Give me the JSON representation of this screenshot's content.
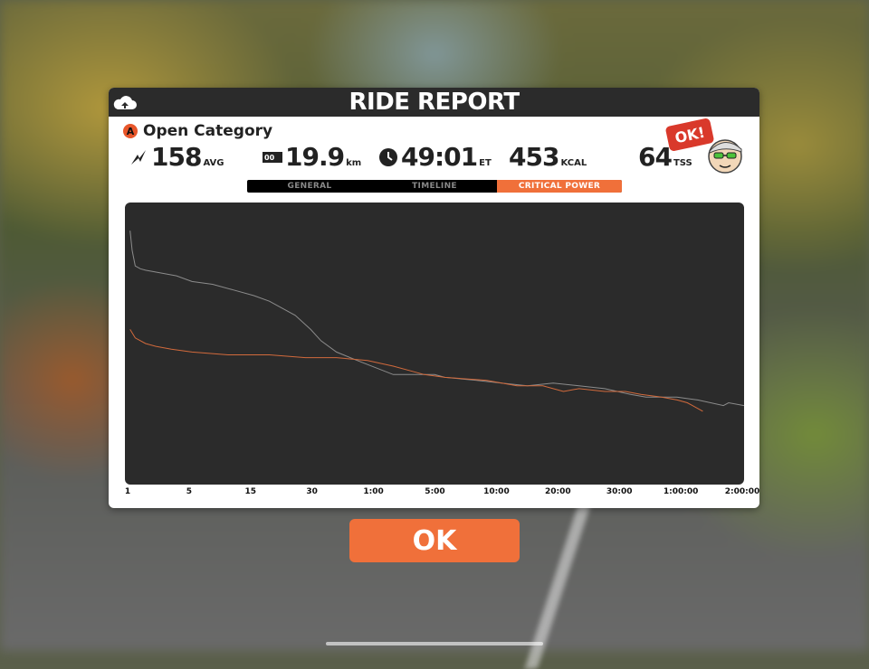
{
  "header": {
    "title": "RIDE REPORT"
  },
  "category": {
    "badge": "A",
    "name": "Open Category"
  },
  "stats": {
    "power": {
      "value": "158",
      "unit": "AVG"
    },
    "distance": {
      "value": "19.9",
      "unit": "km"
    },
    "time": {
      "value": "49:01",
      "unit": "ET"
    },
    "calories": {
      "value": "453",
      "unit": "KCAL"
    },
    "tss": {
      "value": "64",
      "unit": "TSS"
    }
  },
  "ok_bubble": "OK!",
  "tabs": [
    {
      "label": "GENERAL",
      "active": false
    },
    {
      "label": "TIMELINE",
      "active": false
    },
    {
      "label": "CRITICAL POWER",
      "active": true
    }
  ],
  "chart_data": {
    "type": "line",
    "x_ticks": [
      "1",
      "5",
      "15",
      "30",
      "1:00",
      "5:00",
      "10:00",
      "20:00",
      "30:00",
      "1:00:00",
      "2:00:00"
    ],
    "series": [
      {
        "color": "#8c8c8c",
        "values": [
          [
            1,
            0.1
          ],
          [
            1.4,
            0.17
          ],
          [
            2,
            0.225
          ],
          [
            3,
            0.235
          ],
          [
            4,
            0.24
          ],
          [
            7,
            0.25
          ],
          [
            10,
            0.26
          ],
          [
            13,
            0.28
          ],
          [
            17,
            0.29
          ],
          [
            21,
            0.31
          ],
          [
            25,
            0.33
          ],
          [
            28,
            0.35
          ],
          [
            30,
            0.37
          ],
          [
            33,
            0.4
          ],
          [
            36,
            0.45
          ],
          [
            38,
            0.49
          ],
          [
            41,
            0.53
          ],
          [
            45,
            0.56
          ],
          [
            52,
            0.61
          ],
          [
            60,
            0.61
          ],
          [
            62,
            0.62
          ],
          [
            68,
            0.63
          ],
          [
            73,
            0.64
          ],
          [
            78,
            0.65
          ],
          [
            83,
            0.64
          ],
          [
            88,
            0.65
          ],
          [
            93,
            0.66
          ],
          [
            98,
            0.68
          ],
          [
            101,
            0.69
          ],
          [
            104,
            0.69
          ],
          [
            107,
            0.69
          ],
          [
            111,
            0.7
          ],
          [
            116,
            0.72
          ],
          [
            117,
            0.71
          ],
          [
            120,
            0.72
          ]
        ]
      },
      {
        "color": "#d26a3c",
        "values": [
          [
            1,
            0.45
          ],
          [
            2,
            0.48
          ],
          [
            4,
            0.5
          ],
          [
            6,
            0.51
          ],
          [
            9,
            0.52
          ],
          [
            13,
            0.53
          ],
          [
            20,
            0.54
          ],
          [
            28,
            0.54
          ],
          [
            35,
            0.55
          ],
          [
            41,
            0.55
          ],
          [
            47,
            0.56
          ],
          [
            52,
            0.58
          ],
          [
            56,
            0.6
          ],
          [
            58,
            0.61
          ],
          [
            62,
            0.62
          ],
          [
            70,
            0.63
          ],
          [
            76,
            0.65
          ],
          [
            81,
            0.65
          ],
          [
            85,
            0.67
          ],
          [
            88,
            0.66
          ],
          [
            93,
            0.67
          ],
          [
            97,
            0.67
          ],
          [
            100,
            0.68
          ],
          [
            104,
            0.69
          ],
          [
            107,
            0.7
          ],
          [
            109,
            0.71
          ],
          [
            112,
            0.74
          ]
        ]
      }
    ]
  },
  "ok_button": {
    "label": "OK"
  }
}
